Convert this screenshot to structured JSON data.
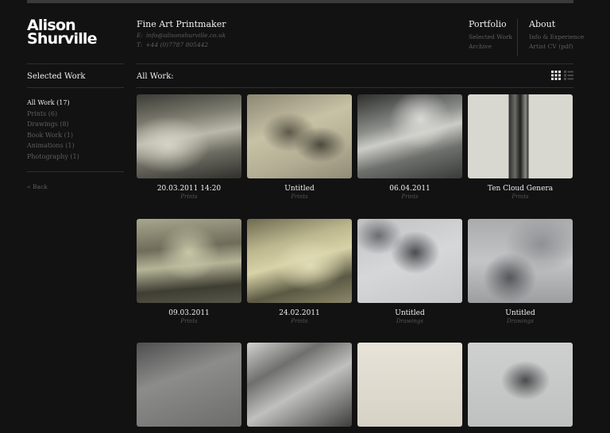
{
  "logo": {
    "line1": "Alison",
    "line2": "Shurville"
  },
  "header": {
    "title": "Fine Art Printmaker",
    "email_label": "E:",
    "email": "info@alisonshurville.co.uk",
    "tel_label": "T:",
    "tel": "+44 (0)7787 805442"
  },
  "nav": {
    "portfolio": {
      "heading": "Portfolio",
      "links": [
        "Selected Work",
        "Archive"
      ]
    },
    "about": {
      "heading": "About",
      "links": [
        "Info & Experience",
        "Artist CV (pdf)"
      ]
    }
  },
  "sidebar": {
    "title": "Selected Work",
    "items": [
      "All Work (17)",
      "Prints (6)",
      "Drawings (8)",
      "Book Work (1)",
      "Animations (1)",
      "Photography (1)"
    ],
    "back": "« Back"
  },
  "main": {
    "heading": "All Work:",
    "view_icons": [
      "grid-view-icon",
      "list-view-icon"
    ],
    "works": [
      {
        "title": "20.03.2011 14:20",
        "category": "Prints"
      },
      {
        "title": "Untitled",
        "category": "Prints"
      },
      {
        "title": "06.04.2011",
        "category": "Prints"
      },
      {
        "title": "Ten Cloud Genera",
        "category": "Prints"
      },
      {
        "title": "09.03.2011",
        "category": "Prints"
      },
      {
        "title": "24.02.2011",
        "category": "Prints"
      },
      {
        "title": "Untitled",
        "category": "Drawings"
      },
      {
        "title": "Untitled",
        "category": "Drawings"
      },
      {
        "title": "",
        "category": ""
      },
      {
        "title": "",
        "category": ""
      },
      {
        "title": "",
        "category": ""
      },
      {
        "title": "",
        "category": ""
      }
    ]
  },
  "colors": {
    "background": "#121212",
    "text": "#f0f0f0",
    "muted": "#5e5e5e",
    "divider": "#2e2e2e"
  }
}
